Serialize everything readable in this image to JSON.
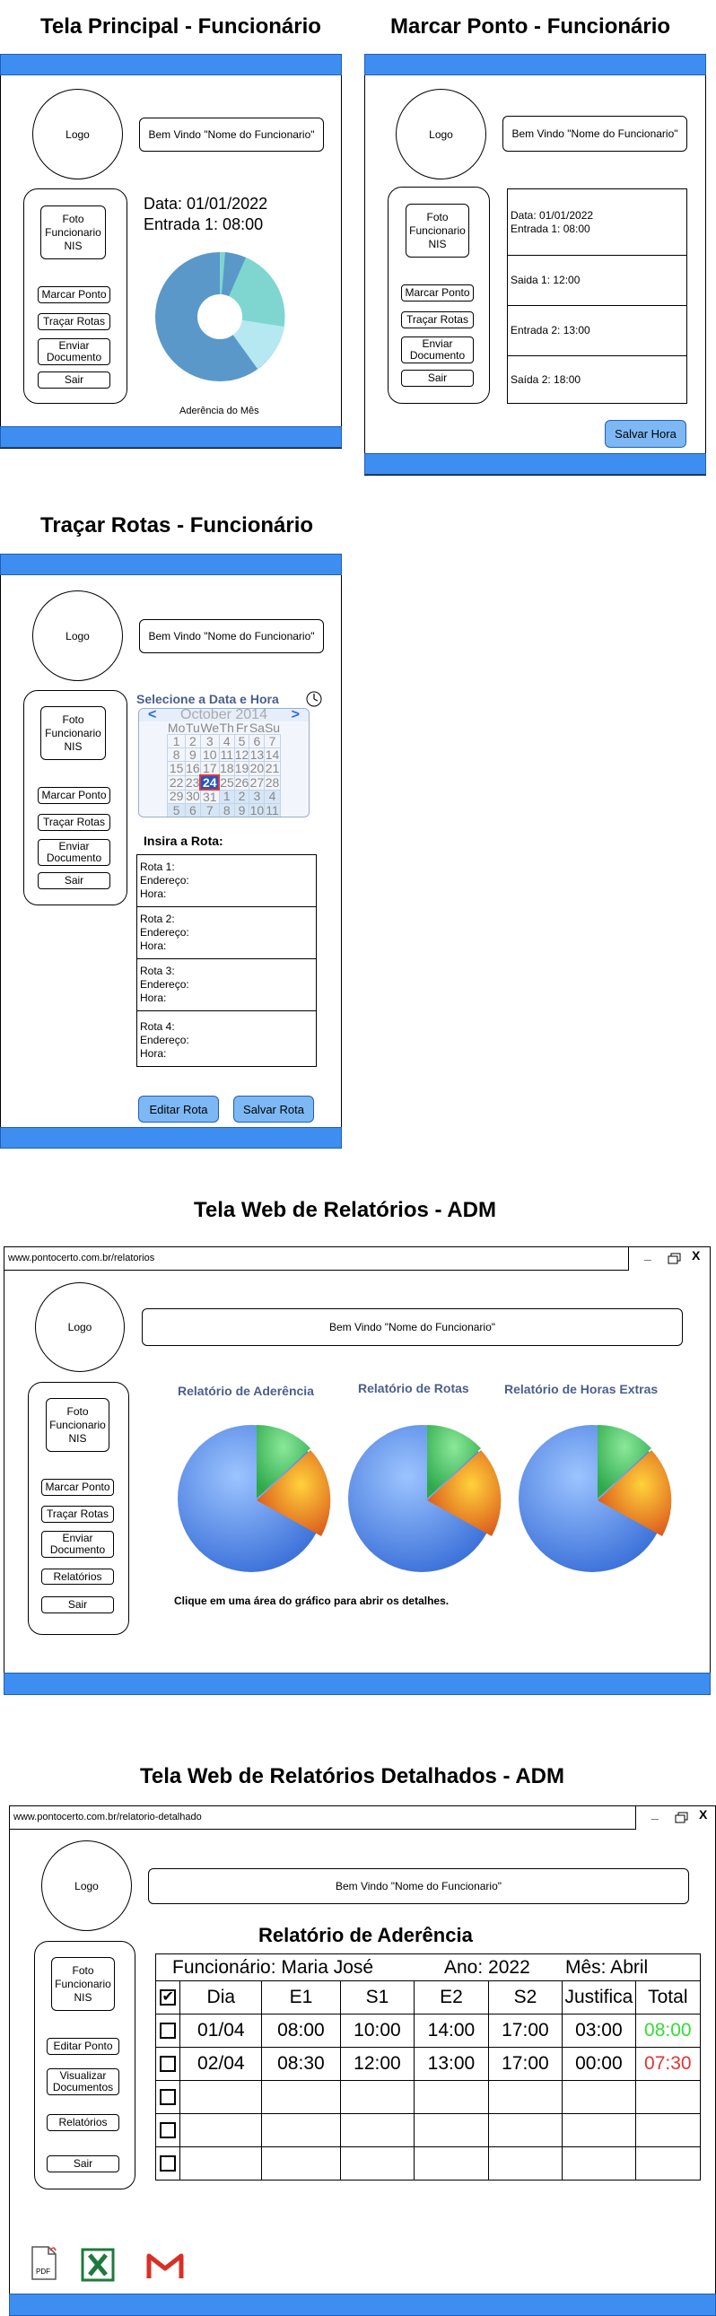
{
  "screens": {
    "principal": {
      "title": "Tela Principal - Funcionário",
      "logo": "Logo",
      "welcome": "Bem Vindo \"Nome do Funcionario\"",
      "photo": [
        "Foto",
        "Funcionario",
        "NIS"
      ],
      "menu": [
        "Marcar Ponto",
        "Traçar Rotas",
        "Enviar Documento",
        "Sair"
      ],
      "date": "Data: 01/01/2022",
      "entry": "Entrada 1: 08:00",
      "chart_caption": "Aderência do Mês"
    },
    "marcar": {
      "title": "Marcar Ponto - Funcionário",
      "logo": "Logo",
      "welcome": "Bem Vindo \"Nome do Funcionario\"",
      "photo": [
        "Foto",
        "Funcionario",
        "NIS"
      ],
      "menu": [
        "Marcar Ponto",
        "Traçar Rotas",
        "Enviar Documento",
        "Sair"
      ],
      "entries": [
        {
          "line1": "Data: 01/01/2022",
          "line2": "Entrada 1: 08:00"
        },
        {
          "line1": "Saida 1: 12:00"
        },
        {
          "line1": "Entrada 2: 13:00"
        },
        {
          "line1": "Saída 2: 18:00"
        }
      ],
      "save_button": "Salvar Hora"
    },
    "rotas": {
      "title": "Traçar Rotas - Funcionário",
      "logo": "Logo",
      "welcome": "Bem Vindo \"Nome do Funcionario\"",
      "photo": [
        "Foto",
        "Funcionario",
        "NIS"
      ],
      "menu": [
        "Marcar Ponto",
        "Traçar Rotas",
        "Enviar Documento",
        "Sair"
      ],
      "date_label": "Selecione a Data e Hora",
      "calendar": {
        "month": "October 2014",
        "prev": "<",
        "next": ">",
        "weekdays": [
          "Mo",
          "Tu",
          "We",
          "Th",
          "Fr",
          "Sa",
          "Su"
        ],
        "weeks": [
          [
            "1",
            "2",
            "3",
            "4",
            "5",
            "6",
            "7"
          ],
          [
            "8",
            "9",
            "10",
            "11",
            "12",
            "13",
            "14"
          ],
          [
            "15",
            "16",
            "17",
            "18",
            "19",
            "20",
            "21"
          ],
          [
            "22",
            "23",
            "24",
            "25",
            "26",
            "27",
            "28"
          ],
          [
            "29",
            "30",
            "31",
            "1",
            "2",
            "3",
            "4"
          ],
          [
            "5",
            "6",
            "7",
            "8",
            "9",
            "10",
            "11"
          ]
        ],
        "selected": "24"
      },
      "route_label": "Insira a Rota:",
      "routes": [
        {
          "name": "Rota 1:",
          "address": "Endereço:",
          "time": "Hora:"
        },
        {
          "name": "Rota 2:",
          "address": "Endereço:",
          "time": "Hora:"
        },
        {
          "name": "Rota 3:",
          "address": "Endereço:",
          "time": "Hora:"
        },
        {
          "name": "Rota 4:",
          "address": "Endereço:",
          "time": "Hora:"
        }
      ],
      "edit_button": "Editar Rota",
      "save_button": "Salvar Rota"
    },
    "relatorios": {
      "title": "Tela Web de Relatórios - ADM",
      "url": "www.pontocerto.com.br/relatorios",
      "win_min": "_",
      "win_close": "X",
      "logo": "Logo",
      "welcome": "Bem Vindo \"Nome do Funcionario\"",
      "photo": [
        "Foto",
        "Funcionario",
        "NIS"
      ],
      "menu": [
        "Marcar Ponto",
        "Traçar Rotas",
        "Enviar Documento",
        "Relatórios",
        "Sair"
      ],
      "chart_titles": [
        "Relatório de Aderência",
        "Relatório de Rotas",
        "Relatório de Horas Extras"
      ],
      "hint": "Clique em uma área do gráfico para abrir os detalhes."
    },
    "detalhados": {
      "title": "Tela Web de Relatórios Detalhados - ADM",
      "url": "www.pontocerto.com.br/relatorio-detalhado",
      "win_min": "_",
      "win_close": "X",
      "logo": "Logo",
      "welcome": "Bem Vindo \"Nome do Funcionario\"",
      "photo": [
        "Foto",
        "Funcionario",
        "NIS"
      ],
      "menu": [
        "Editar Ponto",
        "Visualizar Documentos",
        "Relatórios",
        "Sair"
      ],
      "report_title": "Relatório de Aderência",
      "employee": "Funcionário: Maria José",
      "year": "Ano: 2022",
      "month": "Mês: Abril",
      "headers": [
        "Dia",
        "E1",
        "S1",
        "E2",
        "S2",
        "Justifica",
        "Total"
      ],
      "rows": [
        [
          "01/04",
          "08:00",
          "10:00",
          "14:00",
          "17:00",
          "03:00",
          "08:00"
        ],
        [
          "02/04",
          "08:30",
          "12:00",
          "13:00",
          "17:00",
          "00:00",
          "07:30"
        ],
        [
          "",
          "",
          "",
          "",
          "",
          "",
          ""
        ],
        [
          "",
          "",
          "",
          "",
          "",
          "",
          ""
        ],
        [
          "",
          "",
          "",
          "",
          "",
          "",
          ""
        ]
      ],
      "total_colors": [
        "#33dd33",
        "#e33333"
      ],
      "export_icons": [
        "pdf-icon",
        "excel-icon",
        "gmail-icon"
      ],
      "pdf_label": "PDF"
    }
  },
  "colors": {
    "bar": "#3d8ef0",
    "button": "#7db8f5",
    "donut": [
      "#5a98c9",
      "#7fd6d0",
      "#b5e8f0"
    ]
  }
}
